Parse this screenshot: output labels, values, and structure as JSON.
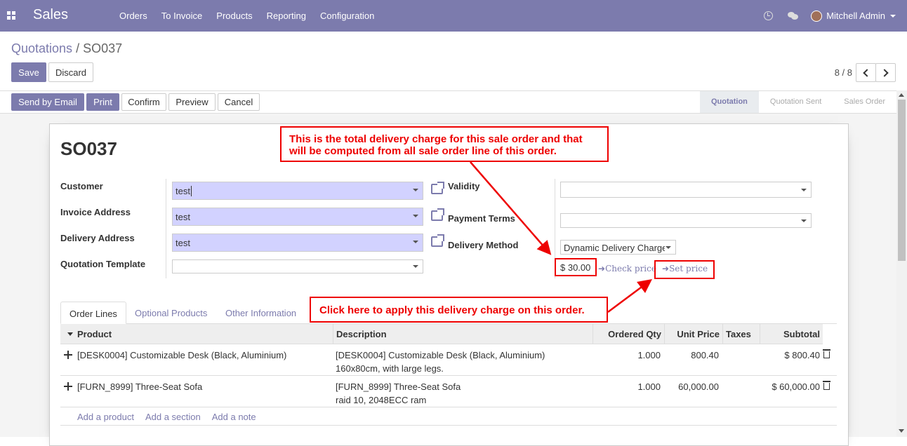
{
  "navbar": {
    "app_name": "Sales",
    "menu": [
      "Orders",
      "To Invoice",
      "Products",
      "Reporting",
      "Configuration"
    ],
    "user": "Mitchell Admin"
  },
  "breadcrumb": {
    "parent": "Quotations",
    "separator": "/",
    "current": "SO037"
  },
  "actions": {
    "save": "Save",
    "discard": "Discard"
  },
  "pager": {
    "value": "8 / 8"
  },
  "header_buttons": {
    "send_email": "Send by Email",
    "print": "Print",
    "confirm": "Confirm",
    "preview": "Preview",
    "cancel": "Cancel"
  },
  "status_steps": [
    "Quotation",
    "Quotation Sent",
    "Sales Order"
  ],
  "form": {
    "title": "SO037",
    "customer_label": "Customer",
    "customer_value": "test",
    "invoice_label": "Invoice Address",
    "invoice_value": "test",
    "delivery_label": "Delivery Address",
    "delivery_value": "test",
    "template_label": "Quotation Template",
    "template_value": "",
    "validity_label": "Validity",
    "validity_value": "",
    "payment_label": "Payment Terms",
    "payment_value": "",
    "method_label": "Delivery Method",
    "method_value": "Dynamic Delivery Charge",
    "delivery_price": "$ 30.00",
    "check_price": "Check price",
    "set_price": "Set price"
  },
  "callouts": {
    "top": "This is the total delivery charge for this sale order and that will be computed from all sale order line of this order.",
    "bottom": "Click here to apply this delivery charge on this order."
  },
  "tabs": [
    "Order Lines",
    "Optional Products",
    "Other Information"
  ],
  "table": {
    "headers": {
      "product": "Product",
      "description": "Description",
      "qty": "Ordered Qty",
      "price": "Unit Price",
      "taxes": "Taxes",
      "subtotal": "Subtotal"
    },
    "rows": [
      {
        "product": "[DESK0004] Customizable Desk (Black, Aluminium)",
        "desc1": "[DESK0004] Customizable Desk (Black, Aluminium)",
        "desc2": "160x80cm, with large legs.",
        "qty": "1.000",
        "price": "800.40",
        "subtotal": "$ 800.40"
      },
      {
        "product": "[FURN_8999] Three-Seat Sofa",
        "desc1": "[FURN_8999] Three-Seat Sofa",
        "desc2": "raid 10, 2048ECC ram",
        "qty": "1.000",
        "price": "60,000.00",
        "subtotal": "$ 60,000.00"
      }
    ],
    "add_product": "Add a product",
    "add_section": "Add a section",
    "add_note": "Add a note"
  },
  "colors": {
    "brand": "#7c7bad",
    "annotation": "#ee0000",
    "required_field": "#d2d2ff"
  }
}
